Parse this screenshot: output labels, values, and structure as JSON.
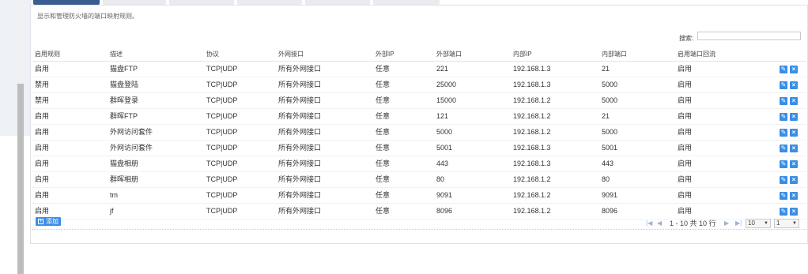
{
  "description": "显示和管理防火墙的端口映射规则。",
  "search": {
    "label": "搜索:",
    "value": ""
  },
  "columns": [
    "启用规则",
    "描述",
    "协议",
    "外网接口",
    "外部IP",
    "外部端口",
    "内部IP",
    "内部端口",
    "启用端口回流"
  ],
  "rows": [
    [
      "启用",
      "猫盘FTP",
      "TCP|UDP",
      "所有外网接口",
      "任意",
      "221",
      "192.168.1.3",
      "21",
      "启用"
    ],
    [
      "禁用",
      "猫盘登陆",
      "TCP|UDP",
      "所有外网接口",
      "任意",
      "25000",
      "192.168.1.3",
      "5000",
      "启用"
    ],
    [
      "禁用",
      "群晖登录",
      "TCP|UDP",
      "所有外网接口",
      "任意",
      "15000",
      "192.168.1.2",
      "5000",
      "启用"
    ],
    [
      "启用",
      "群晖FTP",
      "TCP|UDP",
      "所有外网接口",
      "任意",
      "121",
      "192.168.1.2",
      "21",
      "启用"
    ],
    [
      "启用",
      "外网访问套件",
      "TCP|UDP",
      "所有外网接口",
      "任意",
      "5000",
      "192.168.1.2",
      "5000",
      "启用"
    ],
    [
      "启用",
      "外网访问套件",
      "TCP|UDP",
      "所有外网接口",
      "任意",
      "5001",
      "192.168.1.3",
      "5001",
      "启用"
    ],
    [
      "启用",
      "猫盘相册",
      "TCP|UDP",
      "所有外网接口",
      "任意",
      "443",
      "192.168.1.3",
      "443",
      "启用"
    ],
    [
      "启用",
      "群晖相册",
      "TCP|UDP",
      "所有外网接口",
      "任意",
      "80",
      "192.168.1.2",
      "80",
      "启用"
    ],
    [
      "启用",
      "tm",
      "TCP|UDP",
      "所有外网接口",
      "任意",
      "9091",
      "192.168.1.2",
      "9091",
      "启用"
    ],
    [
      "启用",
      "jf",
      "TCP|UDP",
      "所有外网接口",
      "任意",
      "8096",
      "192.168.1.2",
      "8096",
      "启用"
    ]
  ],
  "row_actions": {
    "edit_icon": "pencil-icon",
    "delete_icon": "close-icon"
  },
  "add_button": {
    "label": "添加"
  },
  "pager": {
    "summary": "1 - 10 共 10 行",
    "page_size": "10",
    "page": "1"
  },
  "colors": {
    "accent": "#3a8ee6",
    "active_tab": "#3c5d90"
  }
}
